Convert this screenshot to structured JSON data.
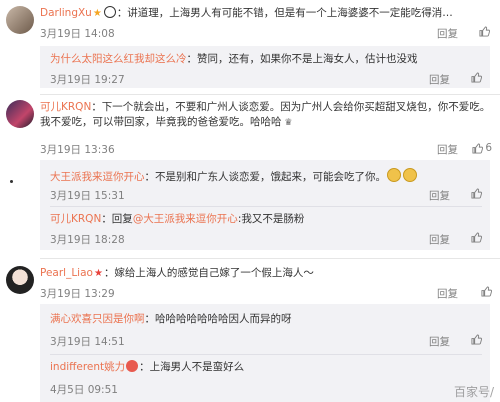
{
  "comments": [
    {
      "user": "DarlingXu",
      "text": "：讲道理，上海男人有可能不错，但是有一个上海婆婆不一定能吃得消…",
      "date": "3月19日 14:08",
      "reply_label": "回复",
      "like_count": "",
      "replies": [
        {
          "user": "为什么太阳这么红我却这么冷",
          "text": "：赞同，还有，如果你不是上海女人，估计也没戏",
          "date": "3月19日 19:27",
          "reply_label": "回复"
        }
      ]
    },
    {
      "user": "可儿KRQN",
      "text": "：下一个就会出，不要和广州人谈恋爱。因为广州人会给你买超甜叉烧包，你不爱吃。我不爱吃，可以带回家，毕竟我的爸爸爱吃。哈哈哈",
      "date": "3月19日 13:36",
      "reply_label": "回复",
      "like_count": "6",
      "replies": [
        {
          "user": "大王派我来逗你开心",
          "text": "：不是别和广东人谈恋爱，饿起来，可能会吃了你。",
          "date": "3月19日 15:31",
          "reply_label": "回复"
        },
        {
          "user": "可儿KRQN",
          "text": "：回复",
          "mention": "@大王派我来逗你开心",
          "text2": ":我又不是肠粉",
          "date": "3月19日 18:28",
          "reply_label": "回复"
        }
      ]
    },
    {
      "user": "Pearl_Liao",
      "text": "：嫁给上海人的感觉自己嫁了一个假上海人～",
      "date": "3月19日 13:29",
      "reply_label": "回复",
      "like_count": "",
      "replies": [
        {
          "user": "满心欢喜只因是你啊",
          "text": "：哈哈哈哈哈哈哈因人而异的呀",
          "date": "3月19日 14:51",
          "reply_label": "回复"
        },
        {
          "user": "indifferent姚力",
          "text": "：上海男人不是蛮好么",
          "date": "4月5日 09:51",
          "reply_label": "回复"
        }
      ]
    }
  ],
  "watermark": "百家号/",
  "colors": {
    "username": "#eb7350",
    "meta": "#808080",
    "reply_bg": "#f2f2f5"
  }
}
